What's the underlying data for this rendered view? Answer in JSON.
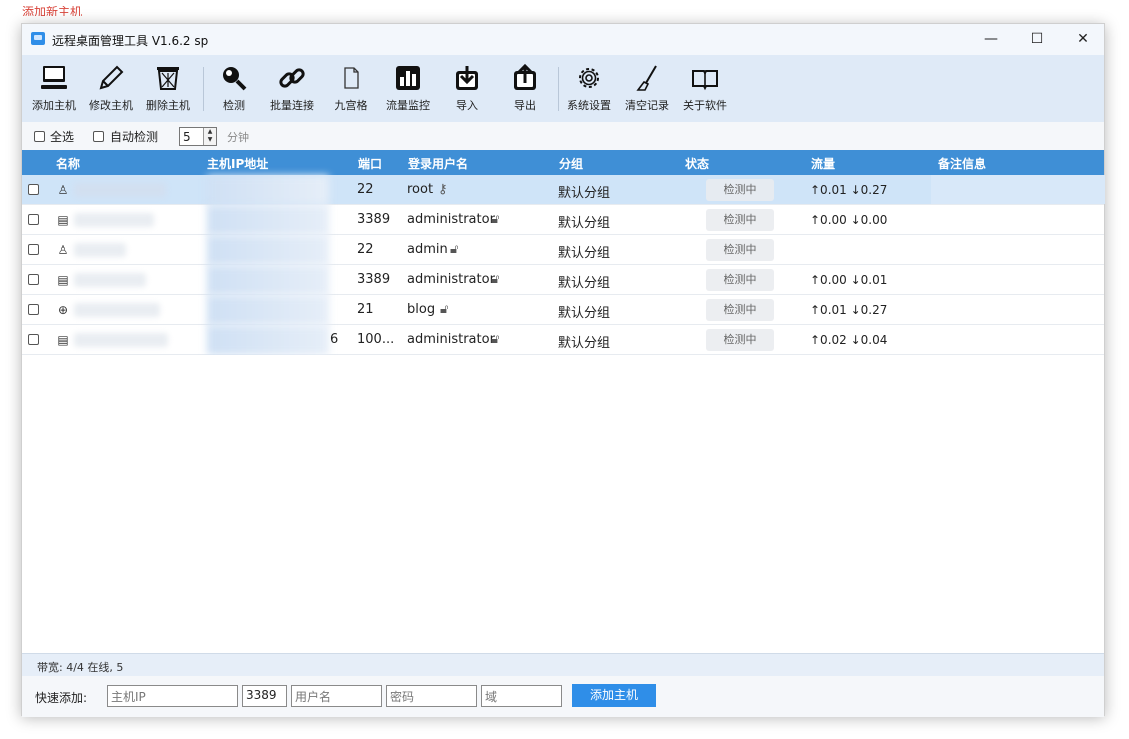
{
  "bg_red_text": "添加新主机",
  "window": {
    "title": "远程桌面管理工具 V1.6.2 sp",
    "minimize": "—",
    "maximize": "☐",
    "close": "✕"
  },
  "toolbar": {
    "items": [
      {
        "label": "添加主机",
        "icon": "computer-icon"
      },
      {
        "label": "修改主机",
        "icon": "pencil-icon"
      },
      {
        "label": "删除主机",
        "icon": "trash-icon"
      },
      {
        "label": "检测",
        "icon": "magnifier-icon"
      },
      {
        "label": "批量连接",
        "icon": "link-icon"
      },
      {
        "label": "九宫格",
        "icon": "document-icon"
      },
      {
        "label": "流量监控",
        "icon": "bar-chart-icon"
      },
      {
        "label": "导入",
        "icon": "import-icon"
      },
      {
        "label": "导出",
        "icon": "export-icon"
      },
      {
        "label": "系统设置",
        "icon": "gear-icon"
      },
      {
        "label": "清空记录",
        "icon": "brush-icon"
      },
      {
        "label": "关于软件",
        "icon": "book-icon"
      }
    ]
  },
  "options": {
    "select_all": "全选",
    "auto_detect": "自动检测",
    "interval_value": "5",
    "interval_unit": "分钟"
  },
  "columns": {
    "name": "名称",
    "ip": "主机IP地址",
    "port": "端口",
    "user": "登录用户名",
    "group": "分组",
    "status": "状态",
    "traffic": "流量",
    "note": "备注信息"
  },
  "rows": [
    {
      "icon": "linux-icon",
      "port": "22",
      "user": "root",
      "user_icon": "key-icon",
      "group": "默认分组",
      "status": "检测中",
      "traffic": "↑0.01 ↓0.27",
      "selected": true
    },
    {
      "icon": "windows-pc-icon",
      "port": "3389",
      "user": "administrator",
      "user_icon": "lock-icon",
      "group": "默认分组",
      "status": "检测中",
      "traffic": "↑0.00 ↓0.00",
      "selected": false
    },
    {
      "icon": "linux-icon",
      "port": "22",
      "user": "admin",
      "user_icon": "lock-icon",
      "group": "默认分组",
      "status": "检测中",
      "traffic": "",
      "selected": false
    },
    {
      "icon": "windows-pc-icon",
      "port": "3389",
      "user": "administrator",
      "user_icon": "lock-icon",
      "group": "默认分组",
      "status": "检测中",
      "traffic": "↑0.00 ↓0.01",
      "selected": false
    },
    {
      "icon": "globe-icon",
      "port": "21",
      "user": "blog",
      "user_icon": "lock-icon",
      "group": "默认分组",
      "status": "检测中",
      "traffic": "↑0.01 ↓0.27",
      "selected": false
    },
    {
      "icon": "windows-pc-icon",
      "port": "100...",
      "user": "administrator",
      "user_icon": "lock-icon",
      "group": "默认分组",
      "status": "检测中",
      "traffic": "↑0.02 ↓0.04",
      "selected": false,
      "ip_tail": "6"
    }
  ],
  "statusbar": {
    "text": "带宽: 4/4 在线, 5"
  },
  "quick_add": {
    "label": "快速添加:",
    "ip_placeholder": "主机IP",
    "port_value": "3389",
    "user_placeholder": "用户名",
    "password_placeholder": "密码",
    "domain_placeholder": "域",
    "button": "添加主机"
  },
  "colors": {
    "accent": "#2f8ee8",
    "header": "#3f8fd6",
    "toolbar_bg": "#dfeaf7",
    "selected_row": "#cfe4f8"
  }
}
